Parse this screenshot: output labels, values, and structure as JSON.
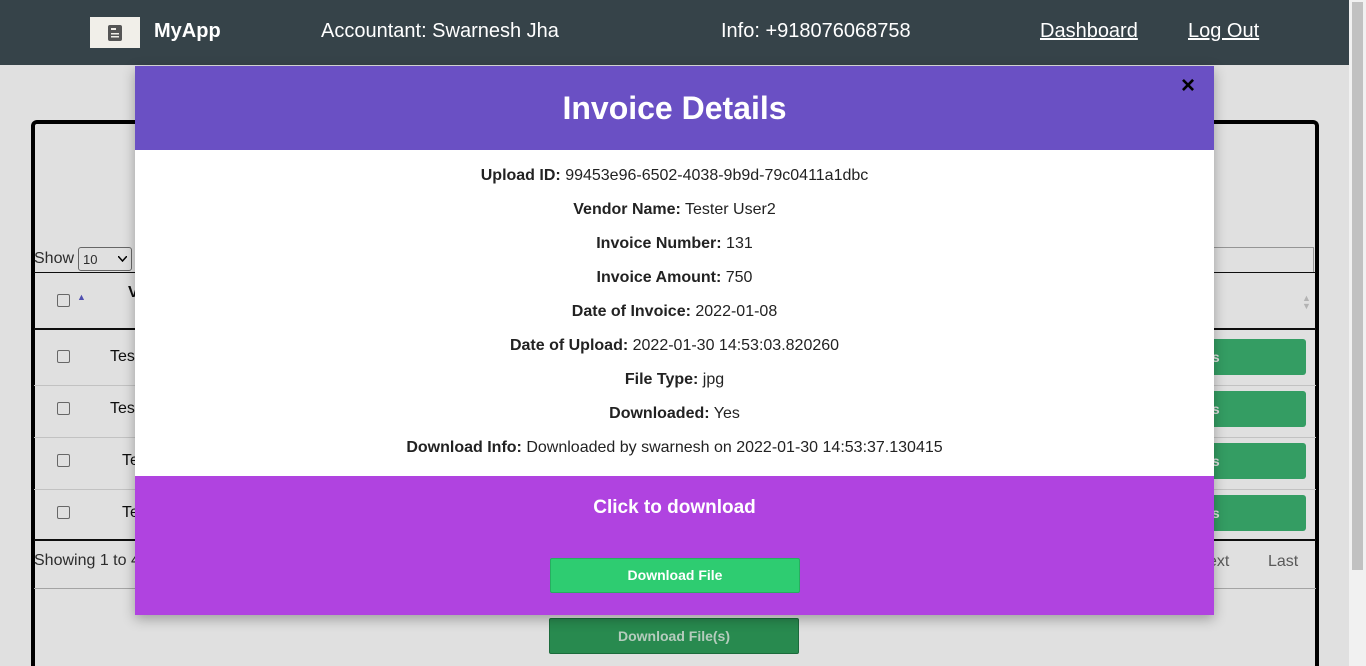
{
  "navbar": {
    "brand": "MyApp",
    "accountant": "Accountant: Swarnesh Jha",
    "info": "Info: +918076068758",
    "links": {
      "dashboard": "Dashboard",
      "logout": "Log Out"
    }
  },
  "background": {
    "show_label": "Show",
    "page_size": "10",
    "rows": [
      {
        "text": "Tes",
        "button": "ls"
      },
      {
        "text": "Tes",
        "button": "ls"
      },
      {
        "text": "Te",
        "button": "ls"
      },
      {
        "text": "Te",
        "button": "ls"
      }
    ],
    "info": "Showing 1 to 4",
    "pager": {
      "next": "ext",
      "last": "Last"
    },
    "download_files_label": "Download File(s)",
    "header_fragment": "V"
  },
  "modal": {
    "title": "Invoice Details",
    "close_glyph": "×",
    "fields": [
      {
        "label": "Upload ID:",
        "value": "99453e96-6502-4038-9b9d-79c0411a1dbc"
      },
      {
        "label": "Vendor Name:",
        "value": "Tester User2"
      },
      {
        "label": "Invoice Number:",
        "value": "131"
      },
      {
        "label": "Invoice Amount:",
        "value": "750"
      },
      {
        "label": "Date of Invoice:",
        "value": "2022-01-08"
      },
      {
        "label": "Date of Upload:",
        "value": "2022-01-30 14:53:03.820260"
      },
      {
        "label": "File Type:",
        "value": "jpg"
      },
      {
        "label": "Downloaded:",
        "value": "Yes"
      },
      {
        "label": "Download Info:",
        "value": "Downloaded by swarnesh on 2022-01-30 14:53:37.130415"
      }
    ],
    "footer_label": "Click to download",
    "download_button": "Download File"
  },
  "colors": {
    "navbar": "#364349",
    "modal_header": "#6a50c4",
    "modal_footer": "#b043e0",
    "download_green": "#2ecc71"
  },
  "icons": {
    "logo": "document-icon",
    "close": "close-icon",
    "sort": "sort-icon"
  }
}
